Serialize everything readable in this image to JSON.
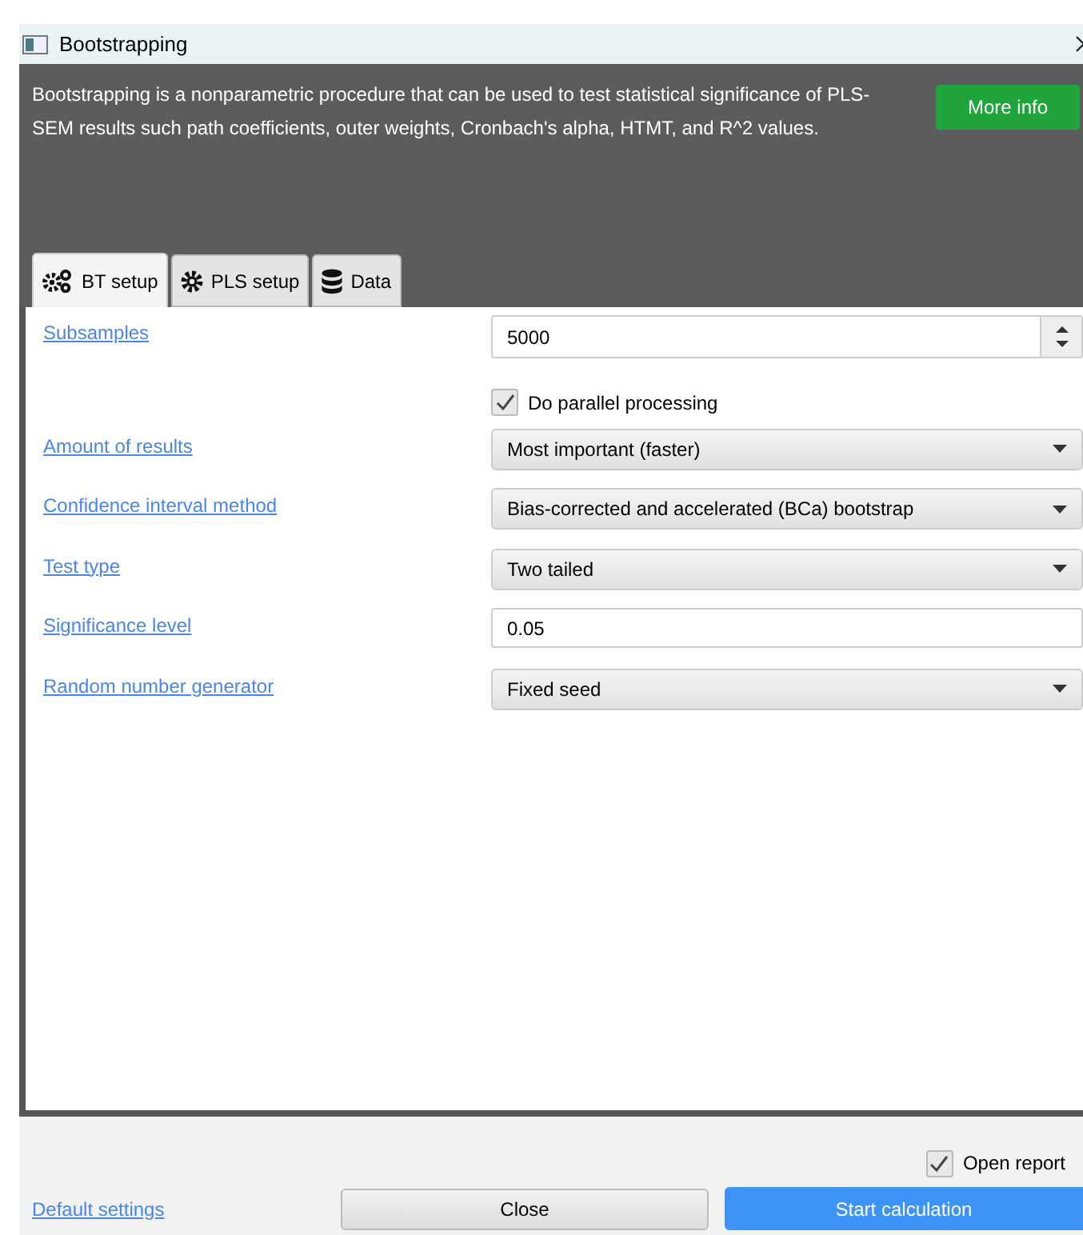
{
  "window": {
    "title": "Bootstrapping"
  },
  "header": {
    "description": "Bootstrapping is a nonparametric procedure that can be used to test statistical significance of PLS-SEM results such path coefficients, outer weights, Cronbach's alpha, HTMT, and R^2 values.",
    "button": "More info"
  },
  "tabs": [
    {
      "label": "BT setup",
      "kind": "gears",
      "selected": true
    },
    {
      "label": "PLS setup",
      "kind": "gear",
      "selected": false
    },
    {
      "label": "Data",
      "kind": "database",
      "selected": false
    }
  ],
  "settings": [
    {
      "kind": "spinner",
      "label": "Subsamples",
      "value": "5000"
    },
    {
      "kind": "checkbox",
      "label": "Do parallel processing",
      "checked": true
    },
    {
      "kind": "select",
      "label": "Amount of results",
      "value": "Most important (faster)"
    },
    {
      "kind": "select",
      "label": "Confidence interval method",
      "value": "Bias-corrected and accelerated (BCa) bootstrap"
    },
    {
      "kind": "select",
      "label": "Test type",
      "value": "Two tailed"
    },
    {
      "kind": "text",
      "label": "Significance level",
      "value": "0.05"
    },
    {
      "kind": "select",
      "label": "Random number generator",
      "value": "Fixed seed"
    }
  ],
  "footer": {
    "open_report": {
      "label": "Open report",
      "checked": true
    },
    "default_link": "Default settings",
    "close_button": "Close",
    "start_button": "Start calculation"
  }
}
